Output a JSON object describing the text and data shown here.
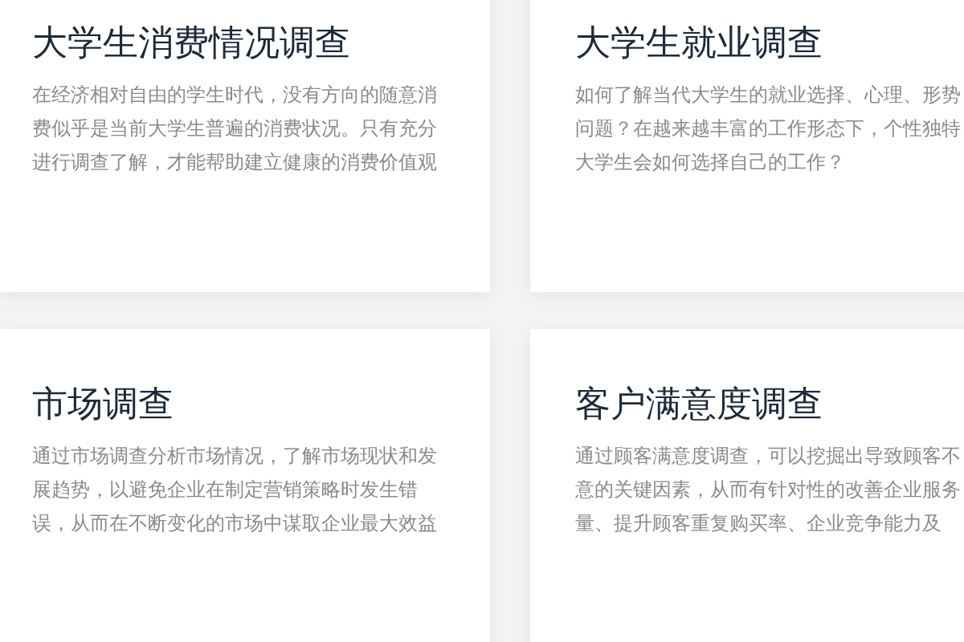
{
  "cards": [
    {
      "title": "大学生消费情况调查",
      "description_lines": [
        "在经济相对自由的学生时代，没有方向的随意消",
        "费似乎是当前大学生普遍的消费状况。只有充分",
        "进行调查了解，才能帮助建立健康的消费价值观"
      ]
    },
    {
      "title": "大学生就业调查",
      "description_lines": [
        "如何了解当代大学生的就业选择、心理、形势",
        "问题？在越来越丰富的工作形态下，个性独特",
        "大学生会如何选择自己的工作？"
      ]
    },
    {
      "title": "市场调查",
      "description_lines": [
        "通过市场调查分析市场情况，了解市场现状和发",
        "展趋势，以避免企业在制定营销策略时发生错",
        "误，从而在不断变化的市场中谋取企业最大效益"
      ]
    },
    {
      "title": "客户满意度调查",
      "description_lines": [
        "通过顾客满意度调查，可以挖掘出导致顾客不",
        "意的关键因素，从而有针对性的改善企业服务",
        "量、提升顾客重复购买率、企业竞争能力及"
      ]
    }
  ]
}
